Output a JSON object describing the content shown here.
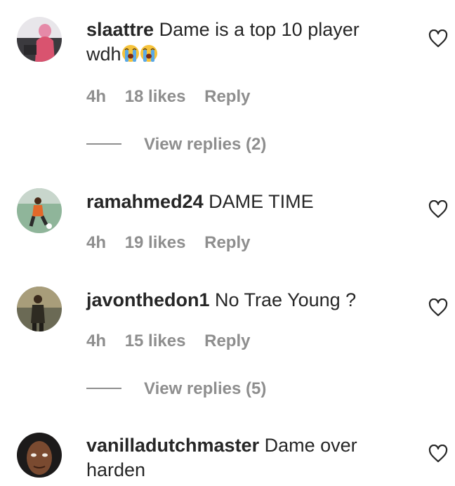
{
  "comments": [
    {
      "username": "slaattre",
      "text": "Dame is a top 10 player wdh",
      "emoji": [
        "loudly-crying-face",
        "loudly-crying-face"
      ],
      "time": "4h",
      "likes": "18 likes",
      "reply_label": "Reply",
      "view_replies": "View replies (2)"
    },
    {
      "username": "ramahmed24",
      "text": "DAME TIME",
      "time": "4h",
      "likes": "19 likes",
      "reply_label": "Reply"
    },
    {
      "username": "javonthedon1",
      "text": "No Trae Young ?",
      "time": "4h",
      "likes": "15 likes",
      "reply_label": "Reply",
      "view_replies": "View replies (5)"
    },
    {
      "username": "vanilladutchmaster",
      "text": "Dame over harden"
    }
  ],
  "icons": {
    "like": "heart-outline-icon"
  },
  "colors": {
    "text": "#262626",
    "secondary": "#8e8e8e",
    "background": "#ffffff"
  }
}
